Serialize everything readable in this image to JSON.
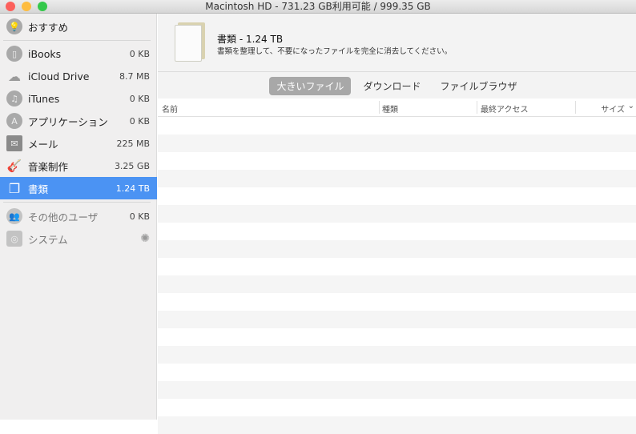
{
  "window": {
    "title": "Macintosh HD - 731.23 GB利用可能 / 999.35 GB",
    "colors": {
      "close": "#fc605c",
      "minimize": "#fdbc40",
      "zoom": "#34c84a",
      "selection": "#4b93f3"
    }
  },
  "sidebar": {
    "recommend": {
      "label": "おすすめ",
      "icon": "lightbulb-icon"
    },
    "items": [
      {
        "label": "iBooks",
        "size": "0 KB",
        "icon": "book-icon"
      },
      {
        "label": "iCloud Drive",
        "size": "8.7 MB",
        "icon": "cloud-icon"
      },
      {
        "label": "iTunes",
        "size": "0 KB",
        "icon": "music-note-icon"
      },
      {
        "label": "アプリケーション",
        "size": "0 KB",
        "icon": "app-store-icon"
      },
      {
        "label": "メール",
        "size": "225 MB",
        "icon": "mail-icon"
      },
      {
        "label": "音楽制作",
        "size": "3.25 GB",
        "icon": "guitar-icon"
      },
      {
        "label": "書類",
        "size": "1.24 TB",
        "icon": "documents-icon",
        "selected": true
      }
    ],
    "others": [
      {
        "label": "その他のユーザ",
        "size": "0 KB",
        "icon": "users-icon"
      },
      {
        "label": "システム",
        "size": "",
        "icon": "system-icon",
        "loading": true
      }
    ]
  },
  "main": {
    "title": "書類 - 1.24 TB",
    "subtitle": "書類を整理して、不要になったファイルを完全に消去してください。",
    "tabs": [
      {
        "label": "大きいファイル",
        "active": true
      },
      {
        "label": "ダウンロード"
      },
      {
        "label": "ファイルブラウザ"
      }
    ],
    "columns": {
      "name": "名前",
      "kind": "種類",
      "last_access": "最終アクセス",
      "size": "サイズ"
    }
  }
}
